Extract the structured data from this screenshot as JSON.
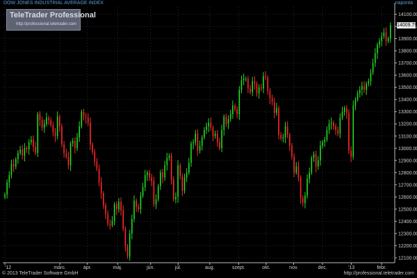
{
  "header": {
    "title": "DOW JONES INDUSTRIAL AVERAGE INDEX",
    "period": "naponta"
  },
  "logo": {
    "brand": "TeleTrader Professional",
    "url": "http://professional.teletrader.com"
  },
  "footer": {
    "copyright": "© 2013 TeleTrader Software GmbH",
    "url": "http://professional.teletrader.com"
  },
  "colors": {
    "up": "#22e022",
    "down": "#ff2a2a",
    "grid": "#2a2a2a",
    "axis": "#c0c0c0",
    "header_text": "#5aa0d8"
  },
  "chart_data": {
    "type": "candlestick",
    "title": "DOW JONES INDUSTRIAL AVERAGE INDEX",
    "period": "naponta",
    "last_value": "14009.79",
    "ylim": [
      12060,
      14160
    ],
    "y_ticks": [
      12100,
      12200,
      12300,
      12400,
      12500,
      12600,
      12700,
      12800,
      12900,
      13000,
      13100,
      13200,
      13300,
      13400,
      13500,
      13600,
      13700,
      13800,
      13900,
      14000,
      14100
    ],
    "x_tick_labels": [
      "'12",
      "márc.",
      "ápr.",
      "máj.",
      "jún.",
      "júl.",
      "aug.",
      "szept.",
      "okt.",
      "nov.",
      "dec.",
      "'13",
      "febr."
    ],
    "x_tick_positions": [
      0,
      40,
      60,
      82,
      106,
      126,
      149,
      170,
      190,
      210,
      231,
      252,
      274
    ],
    "closes": [
      12620,
      12720,
      12780,
      12870,
      12850,
      12910,
      12960,
      12990,
      12940,
      13000,
      12990,
      13050,
      13070,
      13010,
      12960,
      13280,
      13230,
      13170,
      13200,
      13250,
      13230,
      13190,
      13130,
      13100,
      13260,
      13180,
      13030,
      12960,
      12930,
      12860,
      13040,
      13060,
      13000,
      13090,
      13180,
      13300,
      13260,
      13250,
      13210,
      13030,
      12970,
      12890,
      12830,
      12720,
      12630,
      12530,
      12460,
      12380,
      12370,
      12400,
      12540,
      12500,
      12560,
      12490,
      12340,
      12190,
      12110,
      12300,
      12420,
      12570,
      12520,
      12500,
      12610,
      12680,
      12780,
      12800,
      12760,
      12730,
      12540,
      12580,
      12690,
      12800,
      12760,
      12860,
      12920,
      12940,
      12740,
      12580,
      12600,
      12860,
      12770,
      12650,
      12760,
      12800,
      12880,
      13040,
      13050,
      13120,
      12980,
      13020,
      13090,
      13150,
      13180,
      13210,
      13170,
      13100,
      13120,
      13050,
      13000,
      13150,
      13260,
      13200,
      13240,
      13280,
      13350,
      13320,
      13280,
      13480,
      13560,
      13570,
      13570,
      13490,
      13460,
      13550,
      13530,
      13450,
      13500,
      13490,
      13590,
      13580,
      13470,
      13410,
      13380,
      13290,
      13330,
      13110,
      13080,
      13090,
      13180,
      13110,
      13020,
      12930,
      12800,
      12850,
      12760,
      12590,
      12550,
      12610,
      12750,
      12800,
      12920,
      12950,
      12850,
      12900,
      13020,
      13050,
      13070,
      13150,
      13200,
      13210,
      13180,
      13150,
      13120,
      13250,
      13300,
      13330,
      13290,
      12980,
      12930,
      13350,
      13400,
      13450,
      13480,
      13510,
      13480,
      13530,
      13550,
      13620,
      13700,
      13780,
      13850,
      13880,
      13920,
      13950,
      13880,
      13900,
      14009.79
    ]
  }
}
